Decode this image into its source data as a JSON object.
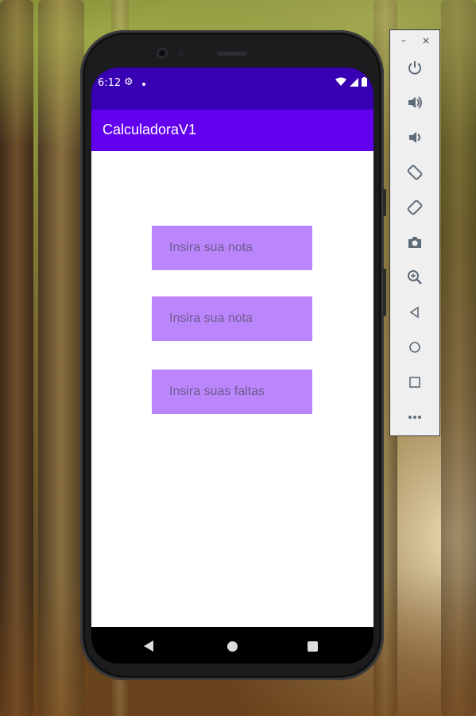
{
  "status_bar": {
    "time": "6:12",
    "gear_glyph": "⚙",
    "wifi_glyph": "▾",
    "signal_glyph": "◢",
    "battery_glyph": "▮"
  },
  "app": {
    "title": "CalculadoraV1",
    "fields": [
      {
        "placeholder": "Insira sua nota"
      },
      {
        "placeholder": "Insira sua nota"
      },
      {
        "placeholder": "Insira suas faltas"
      }
    ]
  },
  "toolbar": {
    "minimize": "–",
    "close": "×",
    "buttons": [
      {
        "icon": "power-icon",
        "glyph": "⏻"
      },
      {
        "icon": "volume-up-icon",
        "glyph": "🔊"
      },
      {
        "icon": "volume-down-icon",
        "glyph": "🔉"
      },
      {
        "icon": "rotate-left-icon",
        "glyph": "⟲"
      },
      {
        "icon": "rotate-right-icon",
        "glyph": "⟳"
      },
      {
        "icon": "camera-icon",
        "glyph": "📷"
      },
      {
        "icon": "zoom-icon",
        "glyph": "⊕"
      },
      {
        "icon": "back-icon",
        "glyph": "◁"
      },
      {
        "icon": "home-icon",
        "glyph": "○"
      },
      {
        "icon": "overview-icon",
        "glyph": "□"
      },
      {
        "icon": "more-icon",
        "glyph": "•••"
      }
    ]
  },
  "colors": {
    "status_bar": "#3700b3",
    "app_bar": "#6200ee",
    "field": "#bb86fc"
  }
}
